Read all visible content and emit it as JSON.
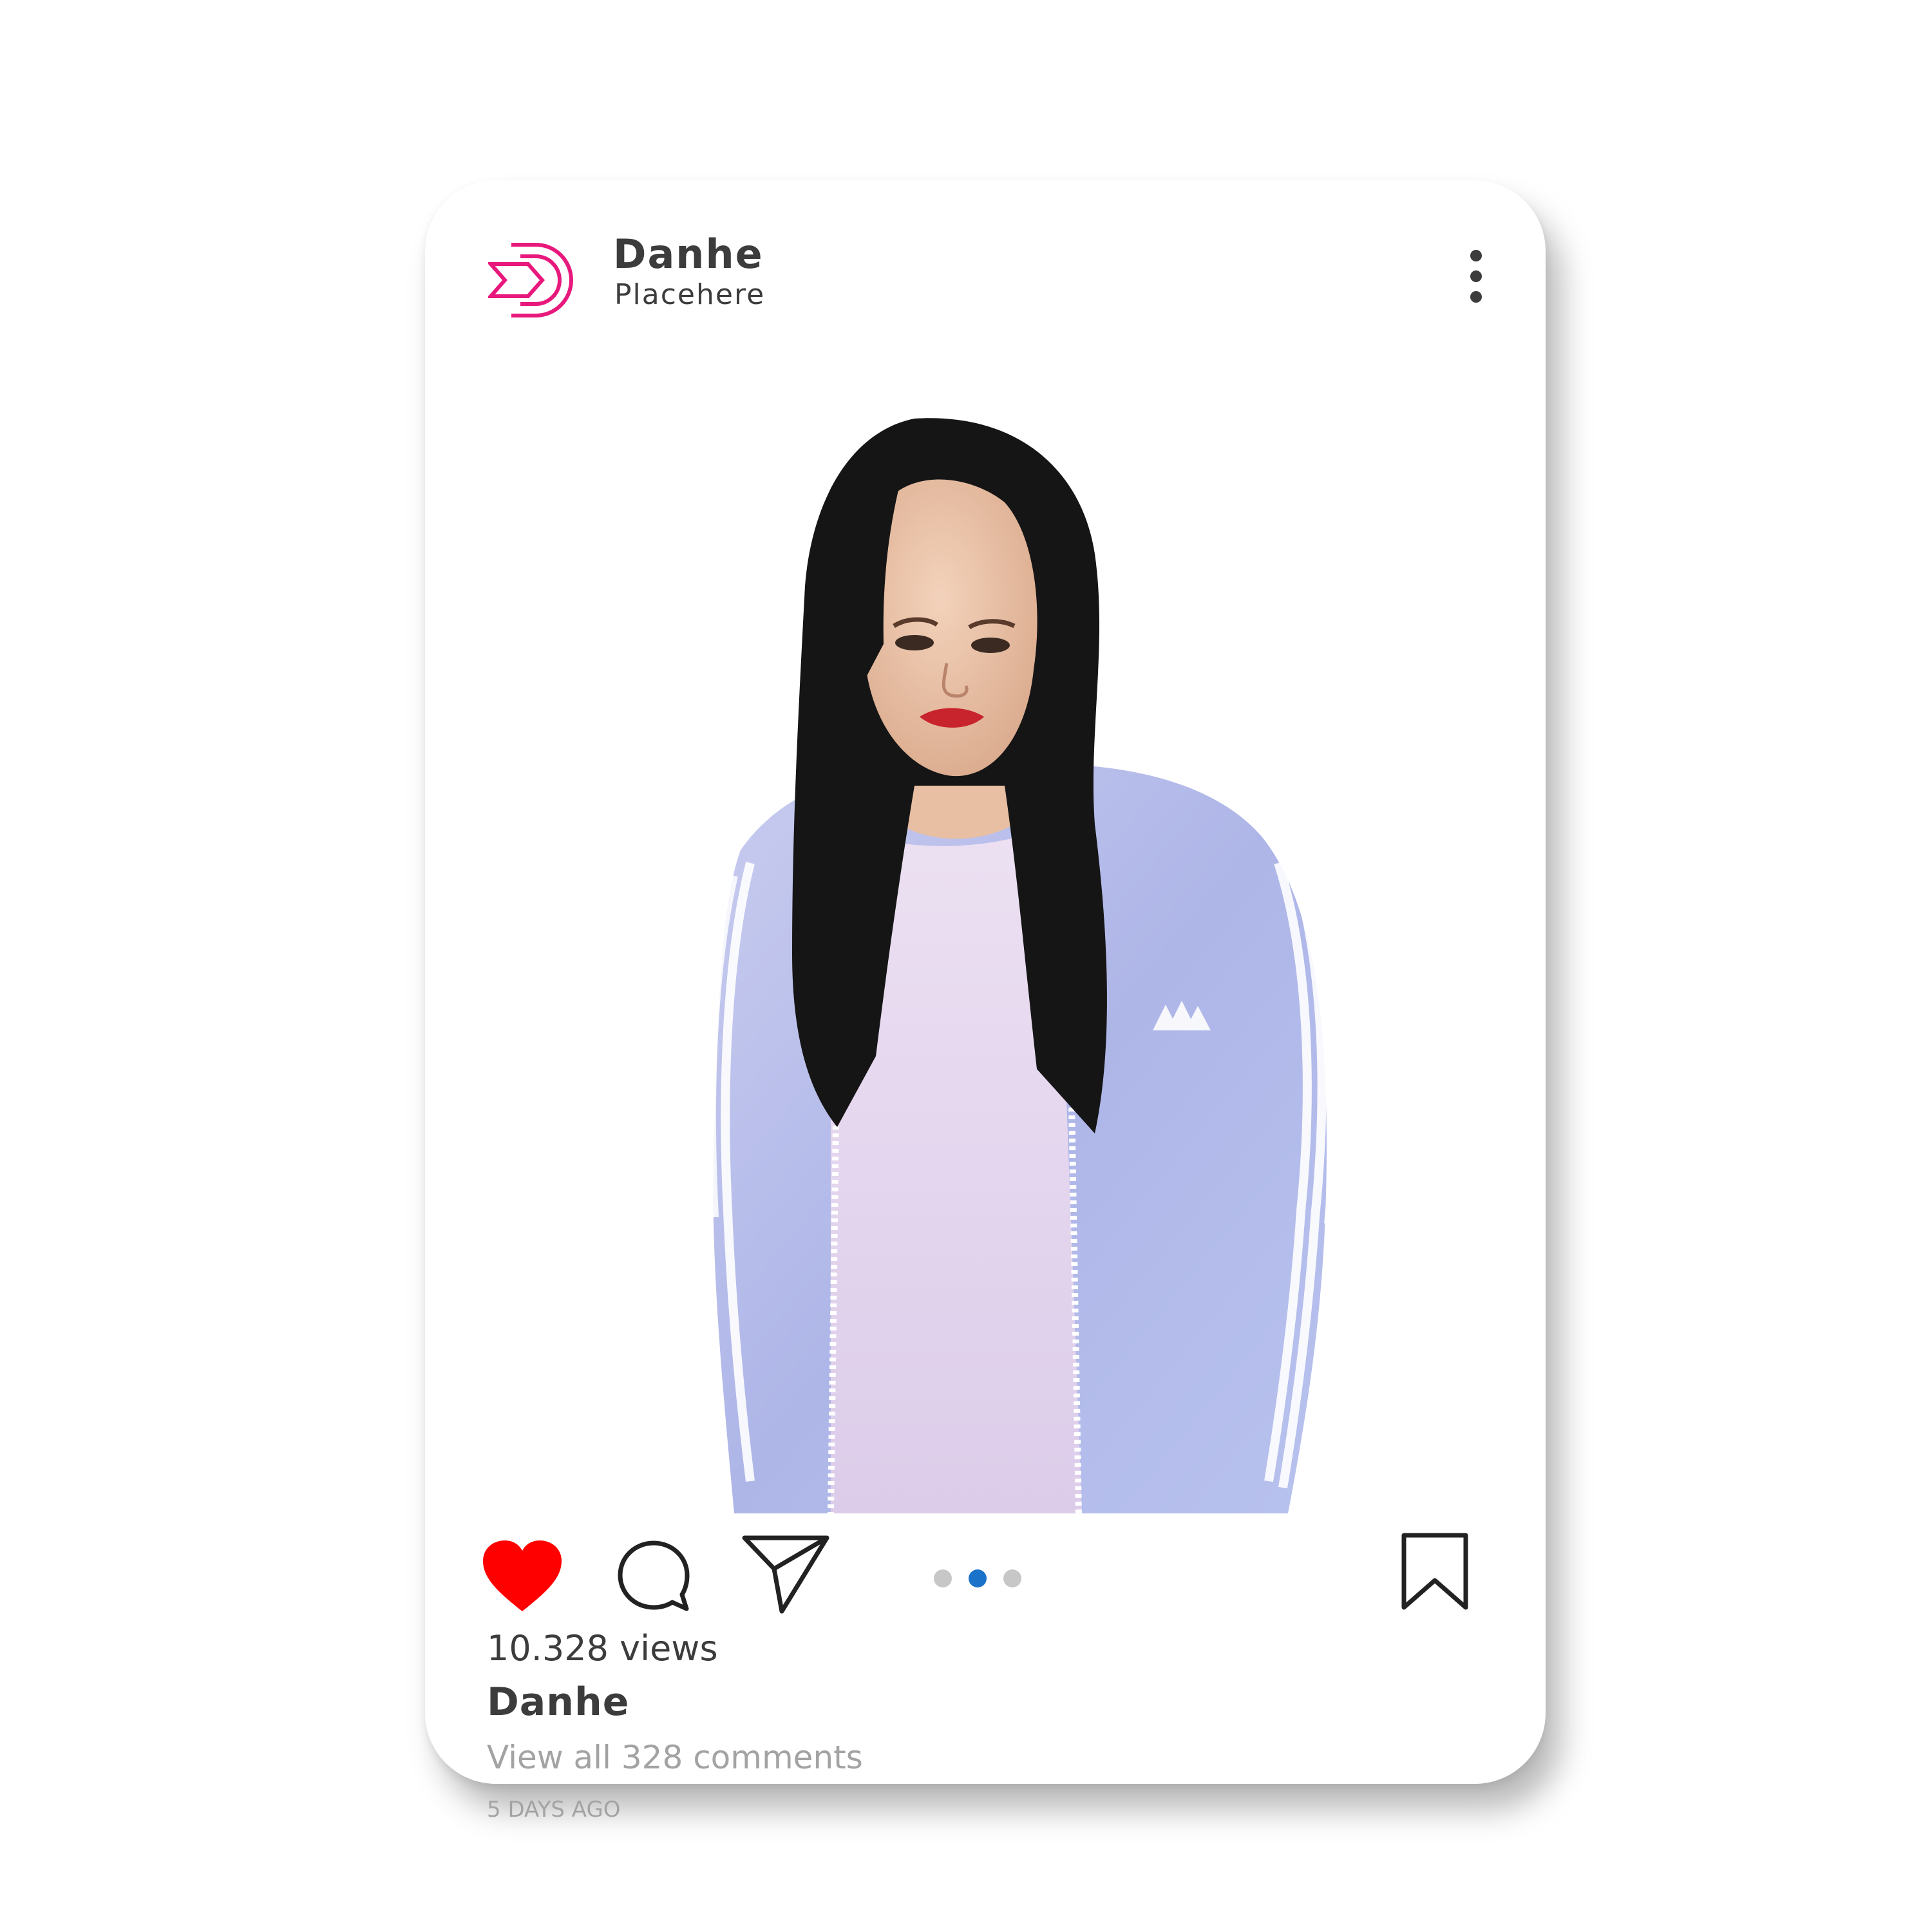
{
  "post": {
    "author": {
      "name": "Danhe",
      "subtitle": "Placehere",
      "logo_icon": "brand-d-logo-icon",
      "brand_color": "#e8197c"
    },
    "menu_icon": "more-vertical-icon",
    "photo_icon": "portrait-photo",
    "actions": {
      "like_icon": "heart-icon",
      "liked": true,
      "like_color": "#ff0000",
      "comment_icon": "comment-bubble-icon",
      "share_icon": "paper-plane-icon",
      "save_icon": "bookmark-icon"
    },
    "carousel": {
      "count": 3,
      "active_index": 1,
      "active_color": "#1a73c8",
      "inactive_color": "#c7c7c7"
    },
    "views": "10.328 views",
    "caption_name": "Danhe",
    "comments_link": "View all 328 comments",
    "timestamp": "5 DAYS AGO"
  }
}
